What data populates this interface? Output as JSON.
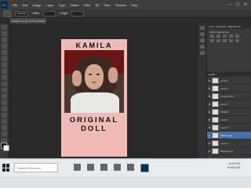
{
  "app": {
    "logo": "Ps",
    "menu": [
      "File",
      "Edit",
      "Image",
      "Layer",
      "Type",
      "Select",
      "Filter",
      "3D",
      "View",
      "Window",
      "Help"
    ],
    "window_controls": [
      "—",
      "▢",
      "✕"
    ]
  },
  "options": {
    "style_value": "Normal",
    "width_label": "Width",
    "height_label": "Height"
  },
  "document": {
    "tab_title": "KAMILA.psd @ 16.7% (RGB/8)"
  },
  "canvas": {
    "title_top": "KAMILA",
    "title_bottom": "ORIGINAL DOLL",
    "background_color": "#f0bbb6"
  },
  "panels": {
    "tabs": [
      "Color",
      "Swatches",
      "Adjustments"
    ],
    "adjustments_label": "Add an adjustment",
    "layers_head": "Layers"
  },
  "layers": [
    {
      "name": "Layer 1"
    },
    {
      "name": "Layer 2"
    },
    {
      "name": "Original Doll"
    },
    {
      "name": "Layer 3"
    },
    {
      "name": "KAMILA"
    },
    {
      "name": "Layer 4"
    },
    {
      "name": "Layer 5"
    },
    {
      "name": "Photo copy"
    },
    {
      "name": "Layer 6"
    },
    {
      "name": "Background"
    }
  ],
  "taskbar": {
    "search_placeholder": "Search Windows",
    "time": "10:39 PM",
    "date": "6/16/2016"
  }
}
